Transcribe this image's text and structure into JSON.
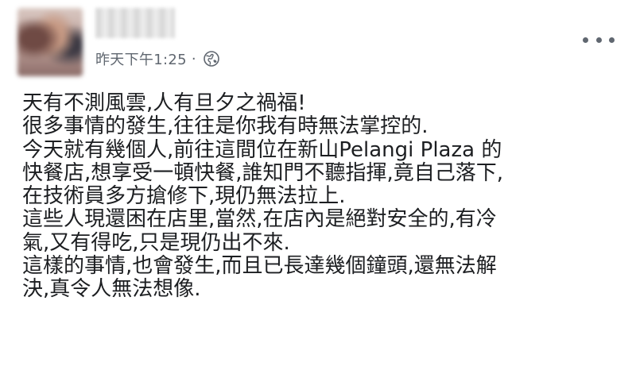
{
  "post": {
    "timestamp": "昨天下午1:25",
    "separator": "·",
    "privacy_icon": "globe-icon",
    "more_icon": "more-options-icon",
    "body_lines": [
      "天有不測風雲,人有旦夕之禍福!",
      "很多事情的發生,往往是你我有時無法掌控的.",
      "今天就有幾個人,前往這間位在新山Pelangi  Plaza  的",
      "快餐店,想享受一頓快餐,誰知門不聽指揮,竟自己落下,",
      "在技術員多方搶修下,現仍無法拉上.",
      "這些人現還困在店里,當然,在店內是絕對安全的,有冷",
      "氣,又有得吃,只是現仍出不來.",
      "這樣的事情,也會發生,而且已長達幾個鐘頭,還無法解",
      "決,真令人無法想像."
    ]
  },
  "colors": {
    "text": "#1c1e21",
    "secondary_text": "#606770",
    "background": "#ffffff"
  }
}
